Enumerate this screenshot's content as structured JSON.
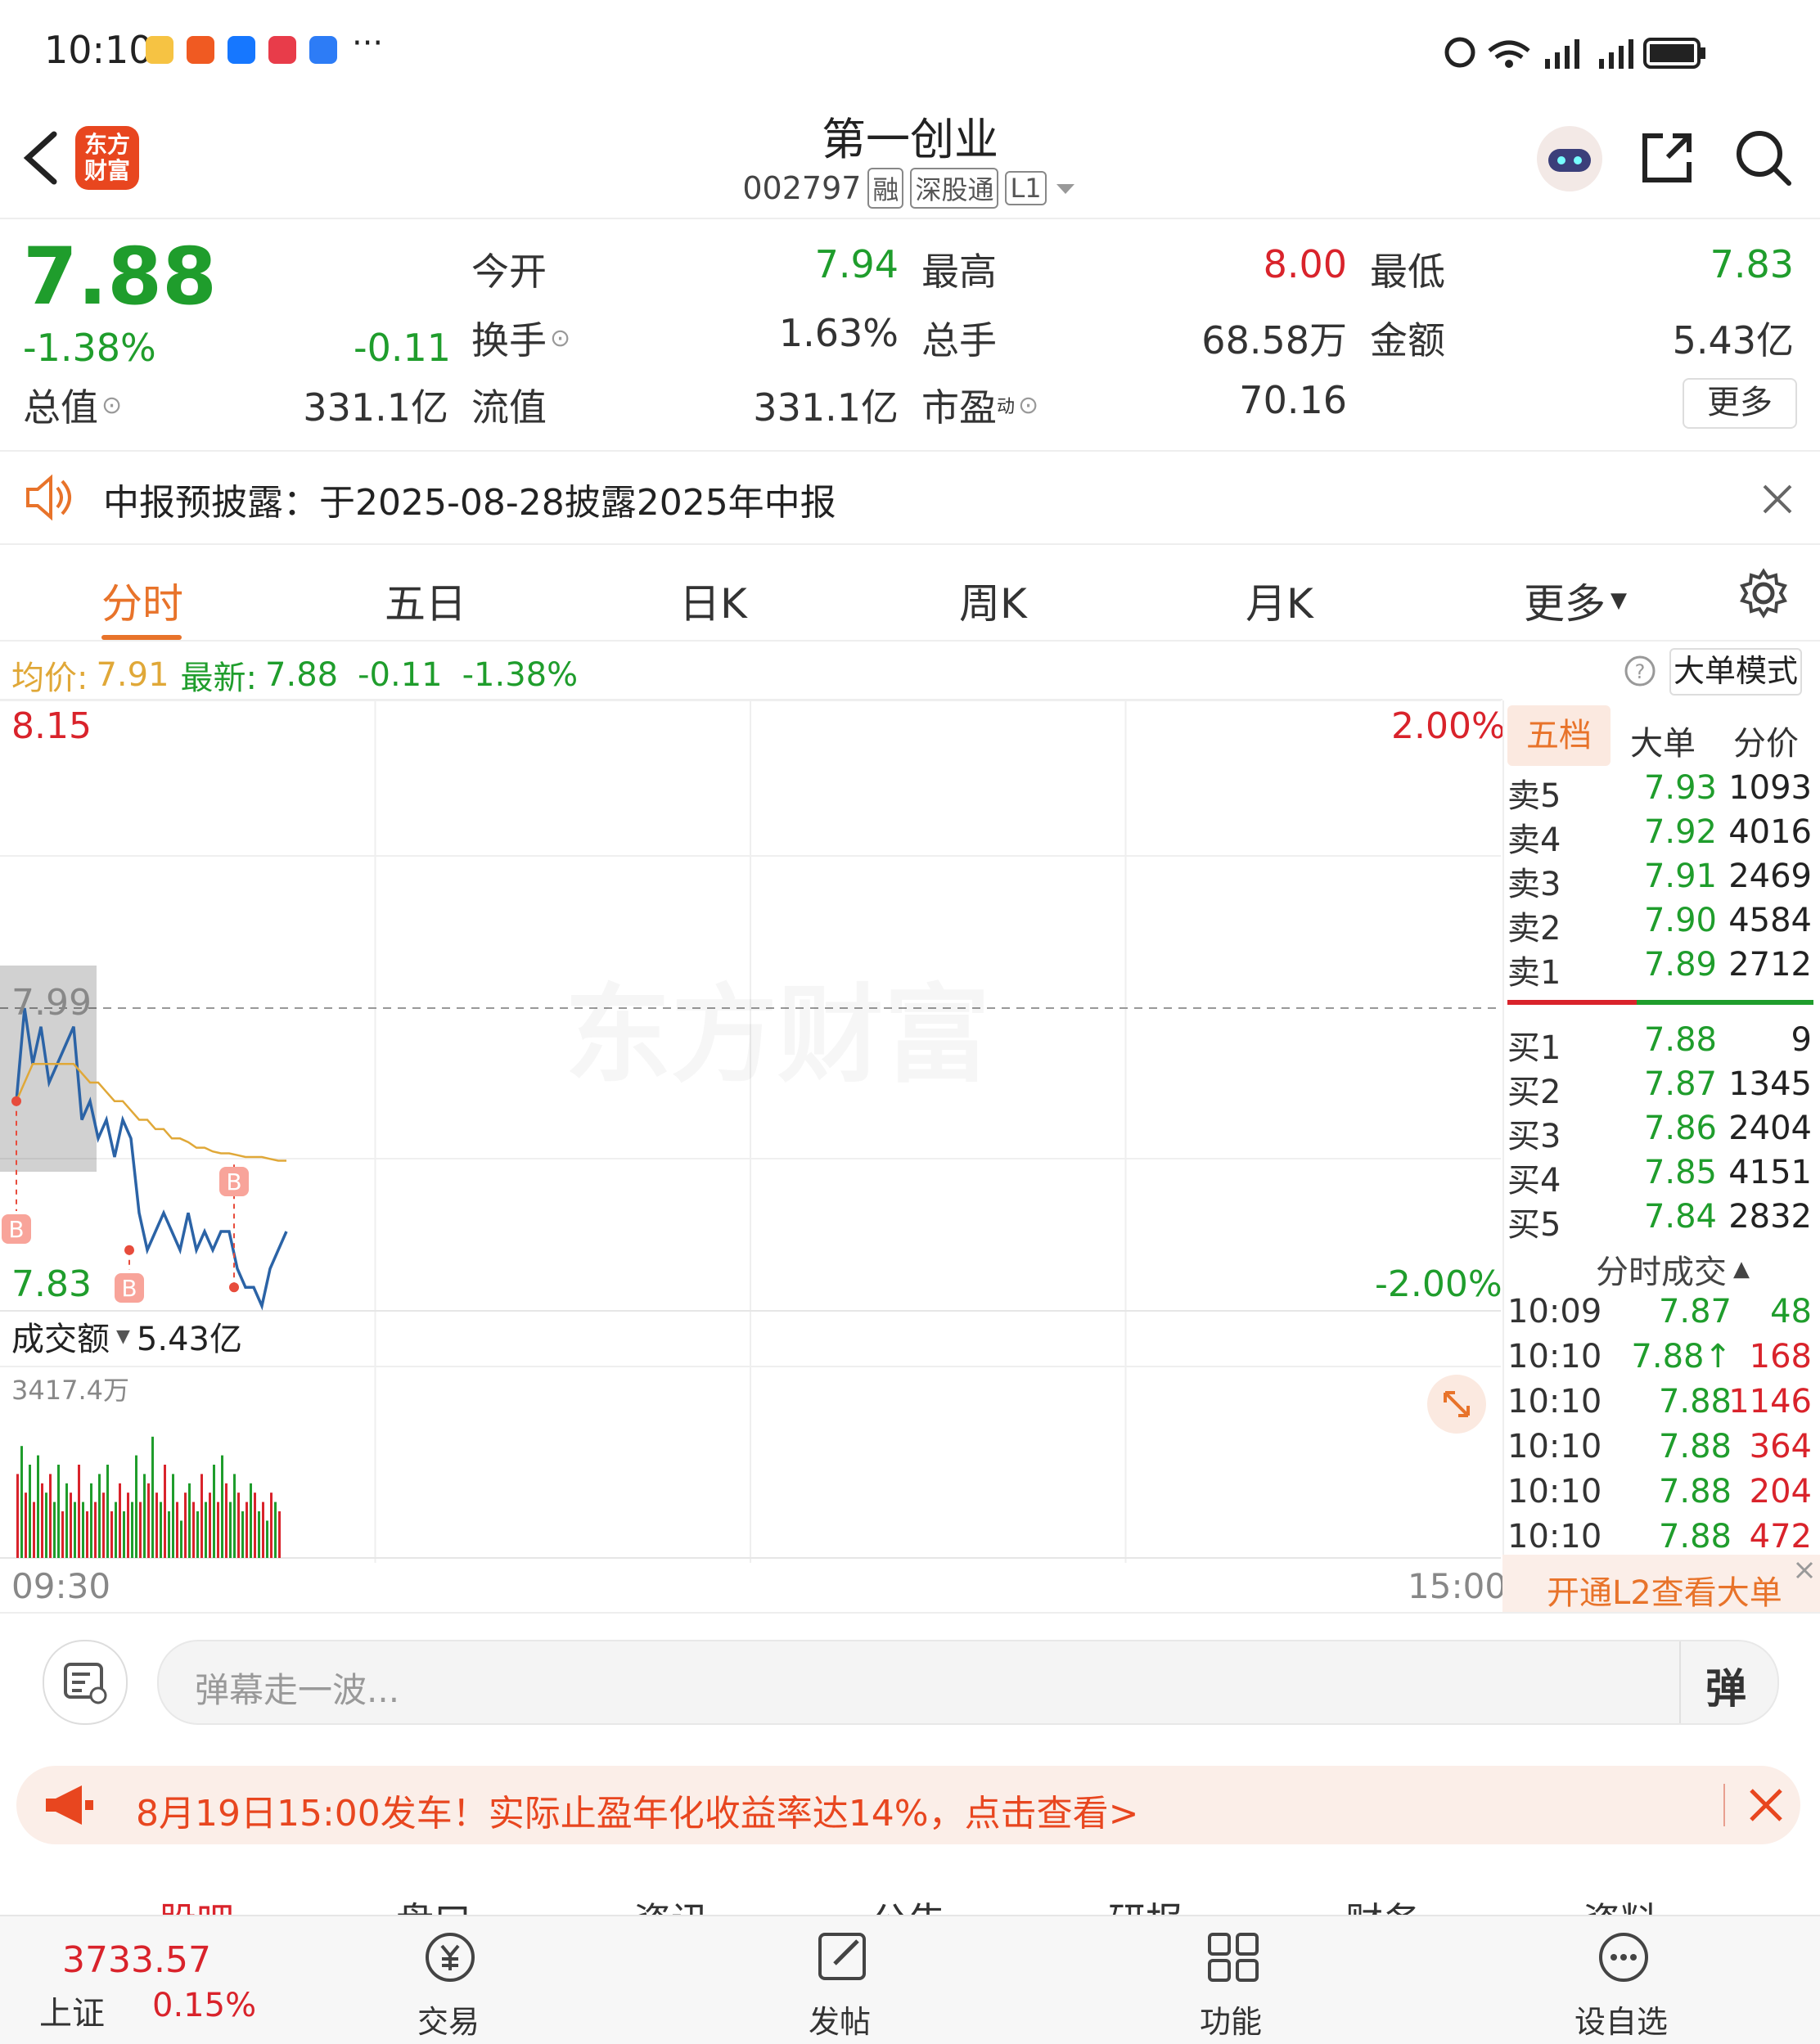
{
  "status_bar": {
    "time": "10:10",
    "more": "···"
  },
  "header": {
    "brand_line1": "东方",
    "brand_line2": "财富",
    "stock_name": "第一创业",
    "stock_code": "002797",
    "tags": [
      "融",
      "深股通",
      "L1"
    ]
  },
  "quote": {
    "price": "7.88",
    "change_pct": "-1.38%",
    "change": "-0.11",
    "open_label": "今开",
    "open": "7.94",
    "high_label": "最高",
    "high": "8.00",
    "low_label": "最低",
    "low": "7.83",
    "turnover_label": "换手",
    "turnover": "1.63%",
    "volume_label": "总手",
    "volume": "68.58万",
    "amount_label": "金额",
    "amount": "5.43亿",
    "mktcap_label": "总值",
    "mktcap": "331.1亿",
    "float_label": "流值",
    "float": "331.1亿",
    "pe_label": "市盈",
    "pe_sup": "动",
    "pe": "70.16",
    "more_button": "更多"
  },
  "notice": {
    "text": "中报预披露：于2025-08-28披露2025年中报"
  },
  "chart_tabs": [
    "分时",
    "五日",
    "日K",
    "周K",
    "月K",
    "更多"
  ],
  "legend": {
    "avg_label": "均价:",
    "avg": "7.91",
    "latest_label": "最新:",
    "latest": "7.88",
    "change": "-0.11",
    "change_pct": "-1.38%",
    "big_order_mode": "大单模式"
  },
  "chart_labels": {
    "y_max": "8.15",
    "y_min": "7.83",
    "pct_max": "2.00%",
    "pct_min": "-2.00%",
    "prev_close": "7.99",
    "time_start": "09:30",
    "time_end": "15:00",
    "watermark": "东方财富",
    "vol_selector": "成交额",
    "vol_total": "5.43亿",
    "vol_max": "3417.4万",
    "marker": "B"
  },
  "chart_data": {
    "type": "line",
    "ylim": [
      7.83,
      8.15
    ],
    "prev_close": 7.99,
    "series": [
      {
        "name": "price",
        "values": [
          7.94,
          7.99,
          7.96,
          7.98,
          7.95,
          7.96,
          7.97,
          7.98,
          7.93,
          7.94,
          7.92,
          7.93,
          7.91,
          7.93,
          7.92,
          7.88,
          7.86,
          7.87,
          7.88,
          7.87,
          7.86,
          7.88,
          7.86,
          7.87,
          7.86,
          7.87,
          7.87,
          7.85,
          7.84,
          7.84,
          7.83,
          7.85,
          7.86,
          7.87
        ]
      },
      {
        "name": "avg",
        "values": [
          7.94,
          7.95,
          7.96,
          7.96,
          7.96,
          7.96,
          7.96,
          7.96,
          7.955,
          7.95,
          7.95,
          7.945,
          7.94,
          7.94,
          7.935,
          7.93,
          7.93,
          7.925,
          7.925,
          7.92,
          7.92,
          7.918,
          7.915,
          7.915,
          7.913,
          7.912,
          7.912,
          7.911,
          7.91,
          7.91,
          7.91,
          7.909,
          7.908,
          7.908
        ]
      }
    ],
    "volume": [
      {
        "v": 0.45,
        "c": "red"
      },
      {
        "v": 0.6,
        "c": "green"
      },
      {
        "v": 0.35,
        "c": "red"
      },
      {
        "v": 0.5,
        "c": "green"
      },
      {
        "v": 0.3,
        "c": "red"
      },
      {
        "v": 0.55,
        "c": "green"
      },
      {
        "v": 0.4,
        "c": "red"
      },
      {
        "v": 0.35,
        "c": "green"
      },
      {
        "v": 0.45,
        "c": "red"
      },
      {
        "v": 0.3,
        "c": "green"
      },
      {
        "v": 0.5,
        "c": "green"
      },
      {
        "v": 0.25,
        "c": "red"
      },
      {
        "v": 0.4,
        "c": "green"
      },
      {
        "v": 0.35,
        "c": "red"
      },
      {
        "v": 0.3,
        "c": "green"
      },
      {
        "v": 0.5,
        "c": "red"
      },
      {
        "v": 0.3,
        "c": "green"
      },
      {
        "v": 0.25,
        "c": "red"
      },
      {
        "v": 0.4,
        "c": "green"
      },
      {
        "v": 0.3,
        "c": "red"
      },
      {
        "v": 0.45,
        "c": "green"
      },
      {
        "v": 0.35,
        "c": "red"
      },
      {
        "v": 0.5,
        "c": "green"
      },
      {
        "v": 0.25,
        "c": "red"
      },
      {
        "v": 0.3,
        "c": "green"
      },
      {
        "v": 0.4,
        "c": "red"
      },
      {
        "v": 0.25,
        "c": "green"
      },
      {
        "v": 0.35,
        "c": "red"
      },
      {
        "v": 0.3,
        "c": "green"
      },
      {
        "v": 0.55,
        "c": "green"
      },
      {
        "v": 0.3,
        "c": "red"
      },
      {
        "v": 0.45,
        "c": "green"
      },
      {
        "v": 0.4,
        "c": "red"
      },
      {
        "v": 0.65,
        "c": "green"
      },
      {
        "v": 0.35,
        "c": "red"
      },
      {
        "v": 0.3,
        "c": "green"
      },
      {
        "v": 0.5,
        "c": "red"
      },
      {
        "v": 0.25,
        "c": "green"
      },
      {
        "v": 0.45,
        "c": "green"
      },
      {
        "v": 0.3,
        "c": "red"
      },
      {
        "v": 0.2,
        "c": "green"
      },
      {
        "v": 0.35,
        "c": "red"
      },
      {
        "v": 0.4,
        "c": "green"
      },
      {
        "v": 0.3,
        "c": "red"
      },
      {
        "v": 0.25,
        "c": "green"
      },
      {
        "v": 0.45,
        "c": "red"
      },
      {
        "v": 0.3,
        "c": "green"
      },
      {
        "v": 0.35,
        "c": "red"
      },
      {
        "v": 0.5,
        "c": "green"
      },
      {
        "v": 0.3,
        "c": "red"
      },
      {
        "v": 0.55,
        "c": "green"
      },
      {
        "v": 0.4,
        "c": "red"
      },
      {
        "v": 0.3,
        "c": "green"
      },
      {
        "v": 0.45,
        "c": "green"
      },
      {
        "v": 0.35,
        "c": "red"
      },
      {
        "v": 0.25,
        "c": "green"
      },
      {
        "v": 0.3,
        "c": "red"
      },
      {
        "v": 0.4,
        "c": "green"
      },
      {
        "v": 0.35,
        "c": "red"
      },
      {
        "v": 0.25,
        "c": "green"
      },
      {
        "v": 0.3,
        "c": "red"
      },
      {
        "v": 0.2,
        "c": "green"
      },
      {
        "v": 0.35,
        "c": "red"
      },
      {
        "v": 0.3,
        "c": "green"
      },
      {
        "v": 0.25,
        "c": "red"
      }
    ]
  },
  "orderbook": {
    "tabs": [
      "五档",
      "大单",
      "分价"
    ],
    "sell": [
      {
        "label": "卖5",
        "price": "7.93",
        "vol": "1093"
      },
      {
        "label": "卖4",
        "price": "7.92",
        "vol": "4016"
      },
      {
        "label": "卖3",
        "price": "7.91",
        "vol": "2469"
      },
      {
        "label": "卖2",
        "price": "7.90",
        "vol": "4584"
      },
      {
        "label": "卖1",
        "price": "7.89",
        "vol": "2712"
      }
    ],
    "buy": [
      {
        "label": "买1",
        "price": "7.88",
        "vol": "9"
      },
      {
        "label": "买2",
        "price": "7.87",
        "vol": "1345"
      },
      {
        "label": "买3",
        "price": "7.86",
        "vol": "2404"
      },
      {
        "label": "买4",
        "price": "7.85",
        "vol": "4151"
      },
      {
        "label": "买5",
        "price": "7.84",
        "vol": "2832"
      }
    ],
    "ticks_title": "分时成交",
    "ticks": [
      {
        "time": "10:09",
        "price": "7.87",
        "vol": "48",
        "vc": "green",
        "arrow": ""
      },
      {
        "time": "10:10",
        "price": "7.88",
        "vol": "168",
        "vc": "red",
        "arrow": "↑"
      },
      {
        "time": "10:10",
        "price": "7.88",
        "vol": "1146",
        "vc": "red",
        "arrow": ""
      },
      {
        "time": "10:10",
        "price": "7.88",
        "vol": "364",
        "vc": "red",
        "arrow": ""
      },
      {
        "time": "10:10",
        "price": "7.88",
        "vol": "204",
        "vc": "red",
        "arrow": ""
      },
      {
        "time": "10:10",
        "price": "7.88",
        "vol": "472",
        "vc": "red",
        "arrow": ""
      }
    ],
    "l2_link": "开通L2查看大单"
  },
  "danmaku": {
    "placeholder": "弹幕走一波...",
    "send": "弹"
  },
  "promo": {
    "text": "8月19日15:00发车！实际止盈年化收益率达14%，点击查看>"
  },
  "sub_tabs": [
    "股吧",
    "盘口",
    "资讯",
    "公告",
    "研报",
    "财务",
    "资料"
  ],
  "bottom_nav": {
    "index_value": "3733.57",
    "index_name": "上证",
    "index_pct": "0.15%",
    "trade": "交易",
    "post": "发帖",
    "func": "功能",
    "watch": "设自选"
  },
  "colors": {
    "up": "#d9232b",
    "down": "#1f9d2c",
    "accent": "#e8732a",
    "price_line": "#2b63a6",
    "avg_line": "#e0a838"
  }
}
